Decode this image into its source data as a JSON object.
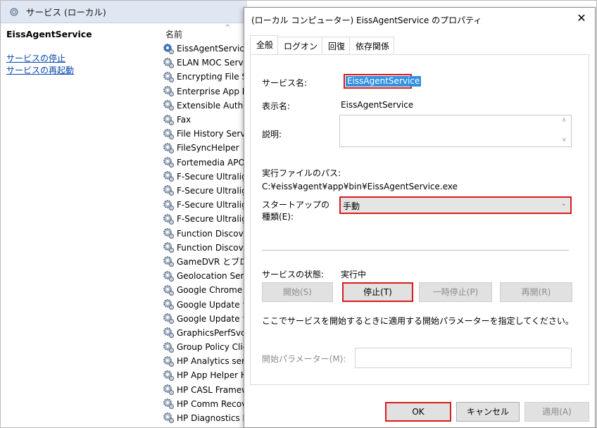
{
  "console": {
    "header_title": "サービス (ローカル)",
    "left_title": "EissAgentService",
    "links": {
      "stop": "サービスの停止",
      "restart": "サービスの再起動"
    },
    "column_header": "名前",
    "services": [
      "EissAgentService",
      "ELAN MOC Servic",
      "Encrypting File Sy",
      "Enterprise App M",
      "Extensible Auther",
      "Fax",
      "File History Servic",
      "FileSyncHelper",
      "Fortemedia APO C",
      "F-Secure Ultraligh",
      "F-Secure Ultraligh",
      "F-Secure Ultraligh",
      "F-Secure Ultraligh",
      "Function Discover",
      "Function Discover",
      "GameDVR とブロー",
      "Geolocation Servi",
      "Google Chrome E",
      "Google Update サ",
      "Google Update サ",
      "GraphicsPerfSvc",
      "Group Policy Clie",
      "HP Analytics servi",
      "HP App Helper HS",
      "HP CASL Framewo",
      "HP Comm Recove",
      "HP Diagnostics H"
    ]
  },
  "dialog": {
    "title": "(ローカル コンピューター) EissAgentService のプロパティ",
    "tabs": [
      "全般",
      "ログオン",
      "回復",
      "依存関係"
    ],
    "service_name_label": "サービス名:",
    "service_name": "EissAgentService",
    "display_name_label": "表示名:",
    "display_name": "EissAgentService",
    "description_label": "説明:",
    "exe_path_label": "実行ファイルのパス:",
    "exe_path": "C:¥eiss¥agent¥app¥bin¥EissAgentService.exe",
    "startup_label_1": "スタートアップの",
    "startup_label_2": "種類(E):",
    "startup_value": "手動",
    "status_label": "サービスの状態:",
    "status_value": "実行中",
    "buttons": {
      "start": "開始(S)",
      "stop": "停止(T)",
      "pause": "一時停止(P)",
      "resume": "再開(R)"
    },
    "param_hint": "ここでサービスを開始するときに適用する開始パラメーターを指定してください。",
    "param_label": "開始パラメーター(M):",
    "ok": "OK",
    "cancel": "キャンセル",
    "apply": "適用(A)"
  }
}
